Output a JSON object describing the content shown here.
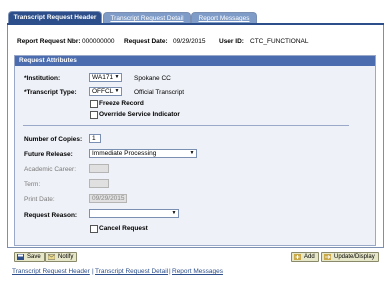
{
  "tabs": [
    {
      "label": "Transcript Request Header"
    },
    {
      "label": "Transcript Request Detail"
    },
    {
      "label": "Report Messages"
    }
  ],
  "header": {
    "report_request_nbr_label": "Report Request Nbr:",
    "report_request_nbr_value": "000000000",
    "request_date_label": "Request Date:",
    "request_date_value": "09/29/2015",
    "user_id_label": "User ID:",
    "user_id_value": "CTC_FUNCTIONAL"
  },
  "request_attributes": {
    "title": "Request Attributes",
    "institution_label": "*Institution:",
    "institution_value": "WA171",
    "institution_desc": "Spokane CC",
    "transcript_type_label": "*Transcript Type:",
    "transcript_type_value": "OFFCL",
    "transcript_type_desc": "Official Transcript",
    "freeze_record_label": "Freeze Record",
    "override_service_label": "Override Service Indicator",
    "number_of_copies_label": "Number of Copies:",
    "number_of_copies_value": "1",
    "future_release_label": "Future Release:",
    "future_release_value": "Immediate Processing",
    "academic_career_label": "Academic Career:",
    "term_label": "Term:",
    "print_date_label": "Print Date:",
    "print_date_value": "09/29/2015",
    "request_reason_label": "Request Reason:",
    "request_reason_value": "",
    "cancel_request_label": "Cancel Request"
  },
  "toolbar": {
    "save_label": "Save",
    "notify_label": "Notify",
    "add_label": "Add",
    "update_display_label": "Update/Display"
  },
  "footer_links": {
    "link1": "Transcript Request Header",
    "link2": "Transcript Request Detail",
    "link3": "Report Messages",
    "separator": "|"
  }
}
